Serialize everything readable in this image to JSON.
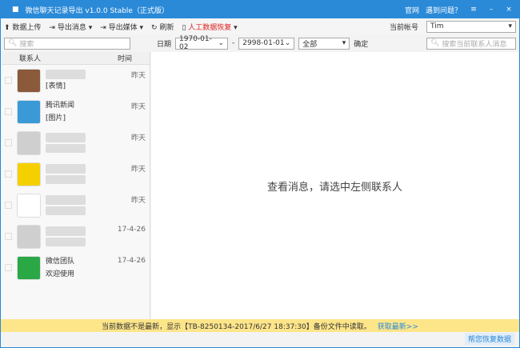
{
  "window": {
    "title": "微信聊天记录导出 v1.0.0 Stable（正式版）",
    "official": "官网",
    "help": "遇到问题？"
  },
  "toolbar": {
    "upload": "数据上传",
    "export_msg": "导出消息",
    "export_media": "导出媒体",
    "refresh": "刷新",
    "manual": "人工数据恢复"
  },
  "filter": {
    "search_placeholder": "搜索",
    "date_label": "日期",
    "date_from": "1970-01-02",
    "date_to": "2998-01-01",
    "type": "全部",
    "ok": "确定",
    "account_label": "当前帐号",
    "account": "Tim",
    "msg_search_placeholder": "搜索当前联系人消息"
  },
  "list": {
    "col_contact": "联系人",
    "col_time": "时间",
    "items": [
      {
        "name": "",
        "msg": "[表情]",
        "time": "昨天",
        "color": "#8a5a3a"
      },
      {
        "name": "腾讯新闻",
        "msg": "[图片]",
        "time": "昨天",
        "color": "#3a9ad8"
      },
      {
        "name": "",
        "msg": "",
        "time": "昨天",
        "color": "#cfcfcf"
      },
      {
        "name": "",
        "msg": "",
        "time": "昨天",
        "color": "#f5d000"
      },
      {
        "name": "",
        "msg": "",
        "time": "昨天",
        "color": "#ffffff"
      },
      {
        "name": "",
        "msg": "",
        "time": "17-4-26",
        "color": "#cfcfcf"
      },
      {
        "name": "微信团队",
        "msg": "欢迎使用",
        "time": "17-4-26",
        "color": "#2aa845"
      }
    ]
  },
  "main": {
    "hint": "查看消息，请选中左侧联系人"
  },
  "status": {
    "text": "当前数据不是最新，显示【TB-8250134-2017/6/27 18:37:30】备份文件中读取。",
    "link": "获取最新>>"
  },
  "footer": {
    "link": "帮您恢复数据"
  }
}
